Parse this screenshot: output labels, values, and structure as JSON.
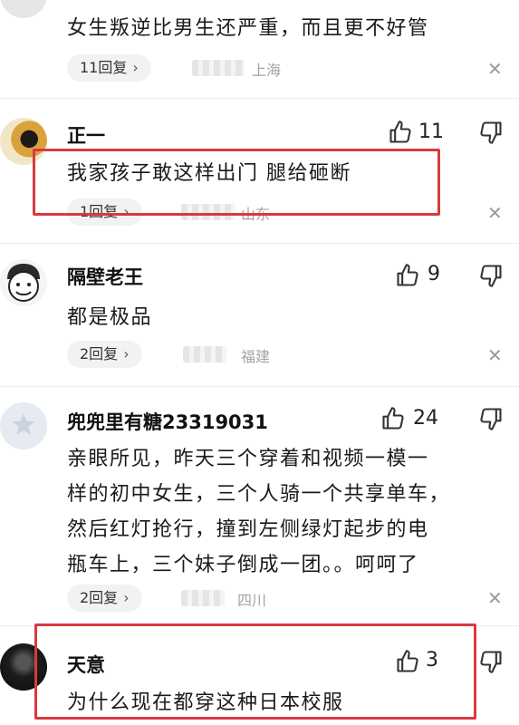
{
  "comments": [
    {
      "body_lines": [
        "女生叛逆比男生还严重，而且更不好管"
      ],
      "replies": "11回复",
      "location": "上海"
    },
    {
      "name": "正一",
      "likes": "11",
      "body_lines": [
        "我家孩子敢这样出门 腿给砸断"
      ],
      "replies": "1回复",
      "location": "山东"
    },
    {
      "name": "隔壁老王",
      "likes": "9",
      "body_lines": [
        "都是极品"
      ],
      "replies": "2回复",
      "location": "福建"
    },
    {
      "name": "兜兜里有糖23319031",
      "likes": "24",
      "body_lines": [
        "亲眼所见，昨天三个穿着和视频一模一",
        "样的初中女生，三个人骑一个共享单车，",
        "然后红灯抢行，撞到左侧绿灯起步的电",
        "瓶车上，三个妹子倒成一团。。呵呵了"
      ],
      "replies": "2回复",
      "location": "四川"
    },
    {
      "name": "天意",
      "likes": "3",
      "body_lines": [
        "为什么现在都穿这种日本校服"
      ]
    }
  ],
  "icons": {
    "reply_chevron": "chevron-right-icon",
    "close": "close-icon",
    "like": "thumbs-up-icon",
    "dislike": "thumbs-down-icon"
  },
  "colors": {
    "highlight_box": "#d9393f",
    "pill_bg": "#f2f2f2",
    "location_text": "#a3a3a3"
  },
  "glyphs": {
    "chevron": "›",
    "close": "✕"
  }
}
